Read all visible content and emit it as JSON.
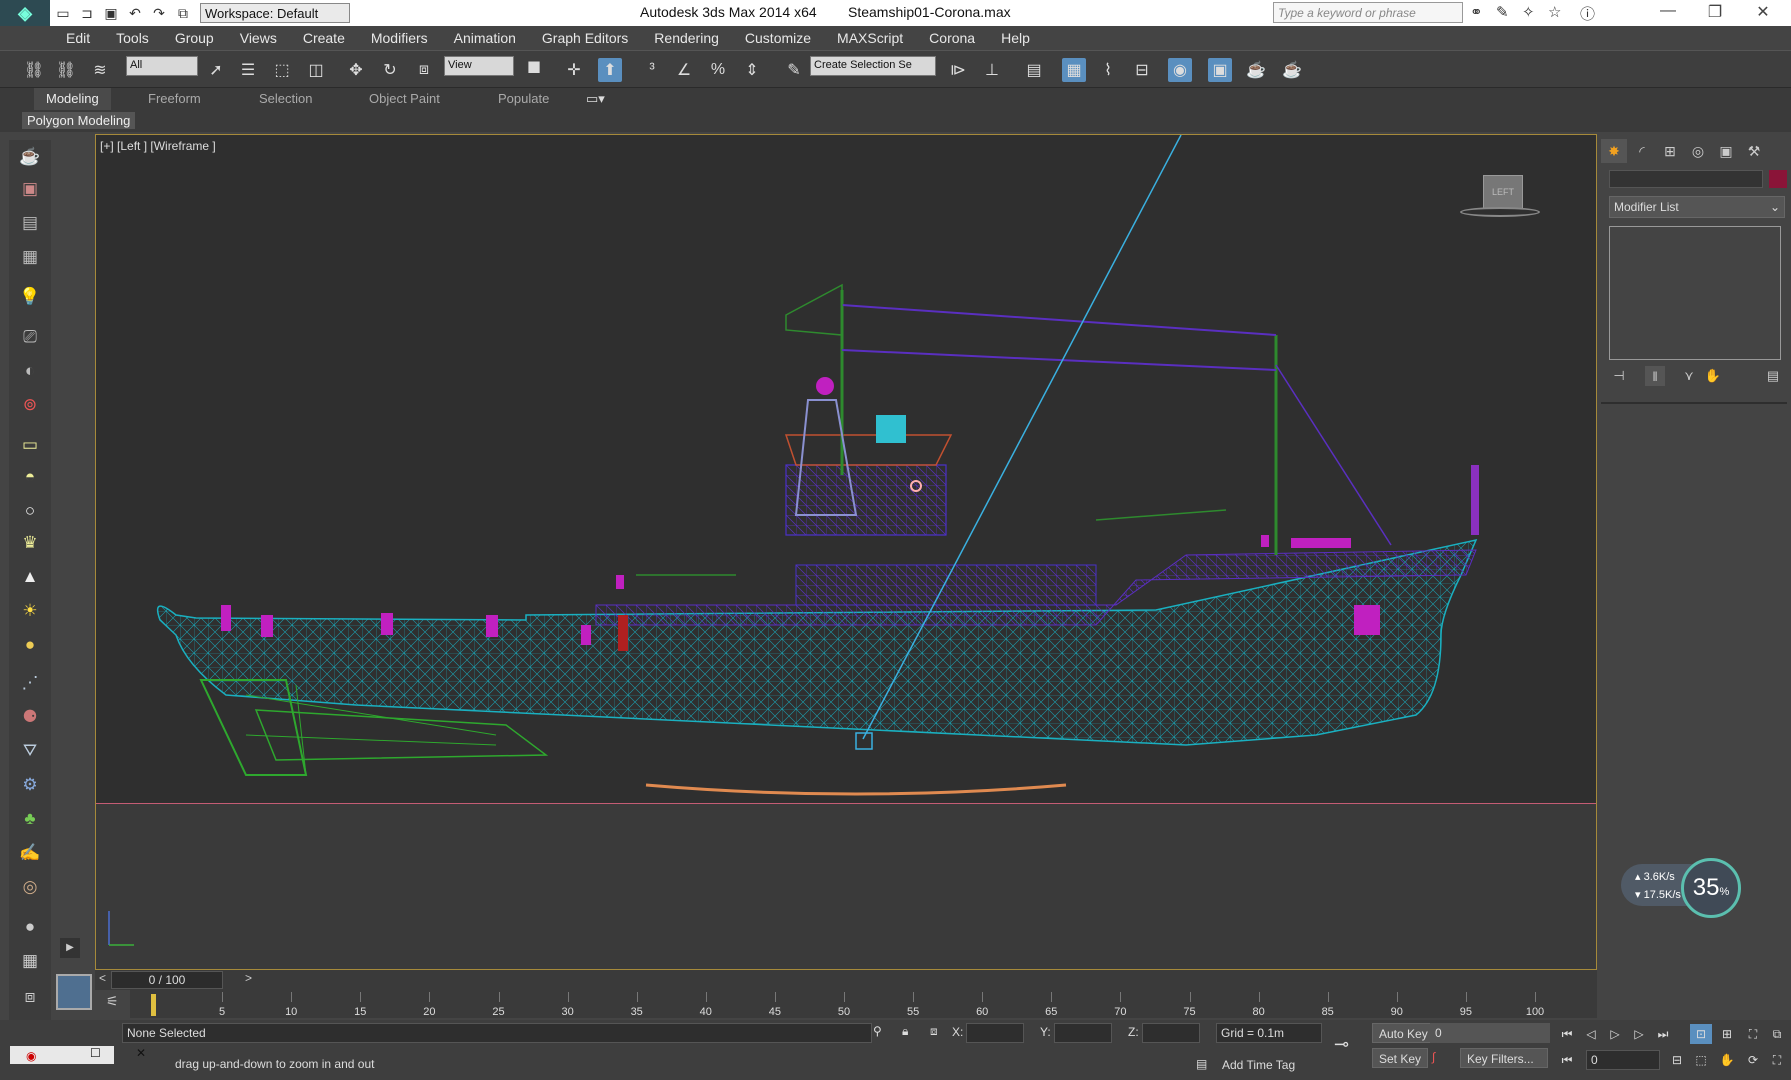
{
  "titlebar": {
    "workspace": "Workspace: Default",
    "app_title": "Autodesk 3ds Max  2014 x64",
    "file_name": "Steamship01-Corona.max",
    "search_placeholder": "Type a keyword or phrase"
  },
  "menu": [
    "Edit",
    "Tools",
    "Group",
    "Views",
    "Create",
    "Modifiers",
    "Animation",
    "Graph Editors",
    "Rendering",
    "Customize",
    "MAXScript",
    "Corona",
    "Help"
  ],
  "toolbar": {
    "selection_filter": "All",
    "ref_coord": "View",
    "named_selection": "Create Selection Se"
  },
  "ribbon": {
    "tabs": [
      "Modeling",
      "Freeform",
      "Selection",
      "Object Paint",
      "Populate"
    ],
    "active_tab": "Modeling",
    "sub_label": "Polygon Modeling"
  },
  "viewport": {
    "label": "[+] [Left ] [Wireframe ]",
    "viewcube_label": "LEFT"
  },
  "command_panel": {
    "modifier_list": "Modifier List",
    "object_color": "#8a1438"
  },
  "net_widget": {
    "upload": "3.6K/s",
    "download": "17.5K/s",
    "percent": "35",
    "percent_sign": "%"
  },
  "timeline": {
    "frame_display": "0 / 100",
    "ticks": [
      "5",
      "10",
      "15",
      "20",
      "25",
      "30",
      "35",
      "40",
      "45",
      "50",
      "55",
      "60",
      "65",
      "70",
      "75",
      "80",
      "85",
      "90",
      "95",
      "100"
    ]
  },
  "status": {
    "selection": "None Selected",
    "prompt": "drag up-and-down to zoom in and out",
    "x_label": "X:",
    "y_label": "Y:",
    "z_label": "Z:",
    "grid": "Grid = 0.1m",
    "add_time_tag": "Add Time Tag",
    "auto_key": "Auto Key",
    "set_key": "Set Key",
    "key_filters": "Key Filters...",
    "key_mode_value": "0",
    "current_frame": "0"
  }
}
